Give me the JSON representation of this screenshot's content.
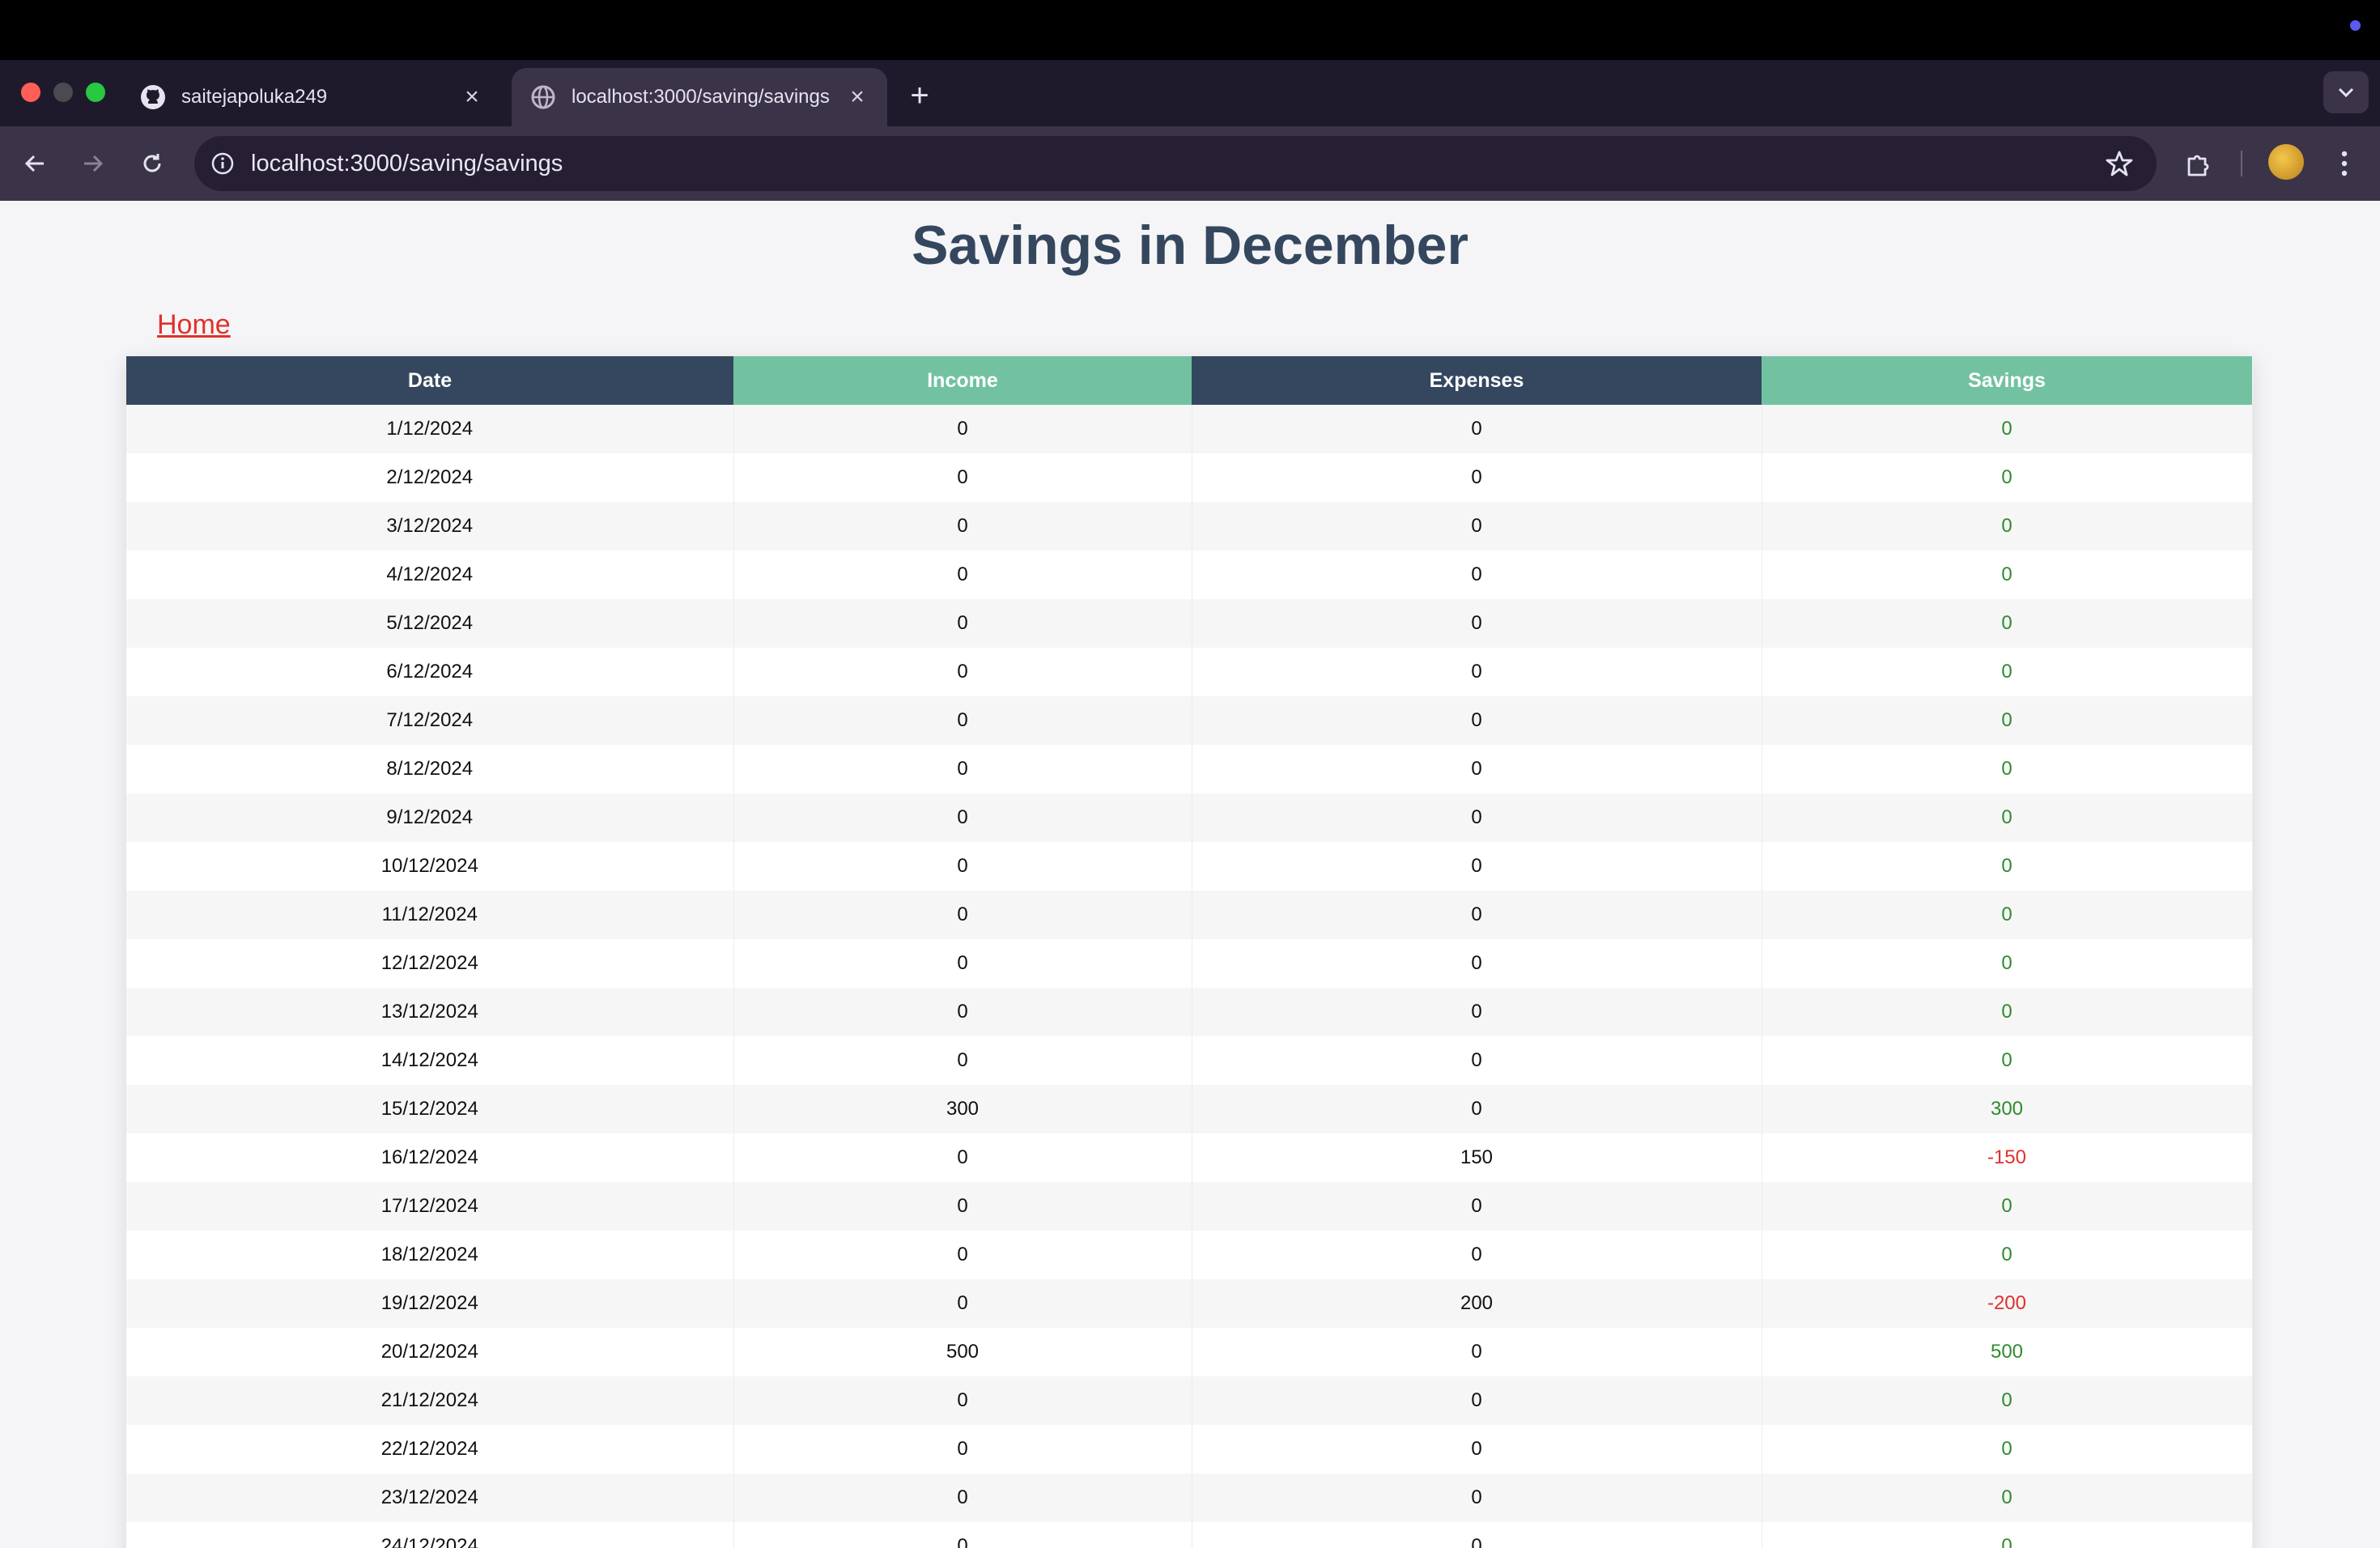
{
  "browser": {
    "tabs": [
      {
        "title": "saitejapoluka249",
        "icon": "github-icon"
      },
      {
        "title": "localhost:3000/saving/savings",
        "icon": "globe-icon"
      }
    ],
    "url": "localhost:3000/saving/savings"
  },
  "page": {
    "title": "Savings in December",
    "home_link": "Home"
  },
  "table": {
    "headers": [
      "Date",
      "Income",
      "Expenses",
      "Savings"
    ],
    "rows": [
      {
        "date": "1/12/2024",
        "income": "0",
        "expenses": "0",
        "savings": "0"
      },
      {
        "date": "2/12/2024",
        "income": "0",
        "expenses": "0",
        "savings": "0"
      },
      {
        "date": "3/12/2024",
        "income": "0",
        "expenses": "0",
        "savings": "0"
      },
      {
        "date": "4/12/2024",
        "income": "0",
        "expenses": "0",
        "savings": "0"
      },
      {
        "date": "5/12/2024",
        "income": "0",
        "expenses": "0",
        "savings": "0"
      },
      {
        "date": "6/12/2024",
        "income": "0",
        "expenses": "0",
        "savings": "0"
      },
      {
        "date": "7/12/2024",
        "income": "0",
        "expenses": "0",
        "savings": "0"
      },
      {
        "date": "8/12/2024",
        "income": "0",
        "expenses": "0",
        "savings": "0"
      },
      {
        "date": "9/12/2024",
        "income": "0",
        "expenses": "0",
        "savings": "0"
      },
      {
        "date": "10/12/2024",
        "income": "0",
        "expenses": "0",
        "savings": "0"
      },
      {
        "date": "11/12/2024",
        "income": "0",
        "expenses": "0",
        "savings": "0"
      },
      {
        "date": "12/12/2024",
        "income": "0",
        "expenses": "0",
        "savings": "0"
      },
      {
        "date": "13/12/2024",
        "income": "0",
        "expenses": "0",
        "savings": "0"
      },
      {
        "date": "14/12/2024",
        "income": "0",
        "expenses": "0",
        "savings": "0"
      },
      {
        "date": "15/12/2024",
        "income": "300",
        "expenses": "0",
        "savings": "300"
      },
      {
        "date": "16/12/2024",
        "income": "0",
        "expenses": "150",
        "savings": "-150"
      },
      {
        "date": "17/12/2024",
        "income": "0",
        "expenses": "0",
        "savings": "0"
      },
      {
        "date": "18/12/2024",
        "income": "0",
        "expenses": "0",
        "savings": "0"
      },
      {
        "date": "19/12/2024",
        "income": "0",
        "expenses": "200",
        "savings": "-200"
      },
      {
        "date": "20/12/2024",
        "income": "500",
        "expenses": "0",
        "savings": "500"
      },
      {
        "date": "21/12/2024",
        "income": "0",
        "expenses": "0",
        "savings": "0"
      },
      {
        "date": "22/12/2024",
        "income": "0",
        "expenses": "0",
        "savings": "0"
      },
      {
        "date": "23/12/2024",
        "income": "0",
        "expenses": "0",
        "savings": "0"
      },
      {
        "date": "24/12/2024",
        "income": "0",
        "expenses": "0",
        "savings": "0"
      }
    ]
  },
  "colors": {
    "header_dark": "#34475e",
    "header_green": "#72c2a2",
    "positive": "#2e8b2e",
    "negative": "#e0312b",
    "link": "#e0312b"
  }
}
